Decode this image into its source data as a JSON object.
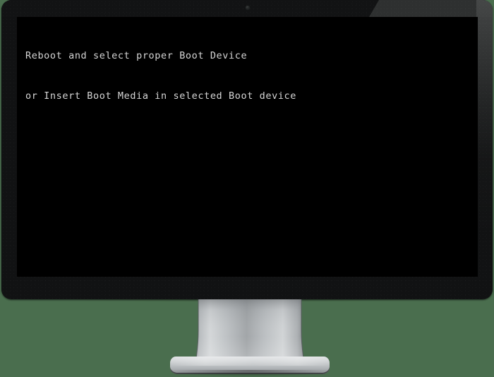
{
  "scene": {
    "background_color": "#4a6e4e",
    "device": "desktop-monitor",
    "power_state": "on"
  },
  "monitor": {
    "bezel_color": "#111213",
    "bezel_gloss_color": "#2e3030",
    "camera_label": "webcam-indicator",
    "stand": {
      "neck_label": "monitor-stand-neck",
      "base_label": "monitor-stand-base",
      "material_color": "#c9ccce"
    }
  },
  "screen": {
    "background_color": "#000000",
    "text_color": "#d6d6d6",
    "console": {
      "lines": [
        "Reboot and select proper Boot Device",
        "or Insert Boot Media in selected Boot device"
      ]
    }
  }
}
